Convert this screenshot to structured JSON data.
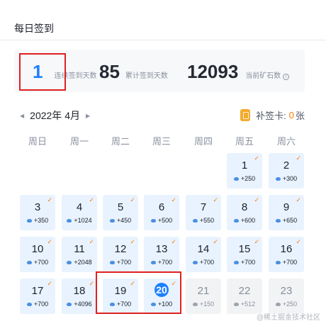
{
  "header": {
    "title": "每日签到"
  },
  "stats": {
    "streak": {
      "value": "1",
      "label": "连续签到天数"
    },
    "total": {
      "value": "85",
      "label": "累计签到天数"
    },
    "ore": {
      "value": "12093",
      "label": "当前矿石数",
      "icon": "info-icon"
    }
  },
  "calendar": {
    "prev_icon": "◀",
    "next_icon": "▶",
    "month_label": "2022年 4月",
    "makeup_label": "补签卡:",
    "makeup_count": "0",
    "makeup_unit": "张",
    "weekdays": [
      "周日",
      "周一",
      "周二",
      "周三",
      "周四",
      "周五",
      "周六"
    ],
    "check_mark": "✓",
    "days": [
      {
        "num": "1",
        "reward": "+250",
        "state": "signed"
      },
      {
        "num": "2",
        "reward": "+300",
        "state": "signed"
      },
      {
        "num": "3",
        "reward": "+350",
        "state": "signed"
      },
      {
        "num": "4",
        "reward": "+1024",
        "state": "signed"
      },
      {
        "num": "5",
        "reward": "+450",
        "state": "signed"
      },
      {
        "num": "6",
        "reward": "+500",
        "state": "signed"
      },
      {
        "num": "7",
        "reward": "+550",
        "state": "signed"
      },
      {
        "num": "8",
        "reward": "+600",
        "state": "signed"
      },
      {
        "num": "9",
        "reward": "+650",
        "state": "signed"
      },
      {
        "num": "10",
        "reward": "+700",
        "state": "signed"
      },
      {
        "num": "11",
        "reward": "+2048",
        "state": "signed"
      },
      {
        "num": "12",
        "reward": "+700",
        "state": "signed"
      },
      {
        "num": "13",
        "reward": "+700",
        "state": "signed"
      },
      {
        "num": "14",
        "reward": "+700",
        "state": "signed"
      },
      {
        "num": "15",
        "reward": "+700",
        "state": "signed"
      },
      {
        "num": "16",
        "reward": "+700",
        "state": "signed"
      },
      {
        "num": "17",
        "reward": "+700",
        "state": "signed"
      },
      {
        "num": "18",
        "reward": "+4096",
        "state": "signed"
      },
      {
        "num": "19",
        "reward": "+700",
        "state": "signed"
      },
      {
        "num": "20",
        "reward": "+100",
        "state": "today"
      },
      {
        "num": "21",
        "reward": "+150",
        "state": "future"
      },
      {
        "num": "22",
        "reward": "+512",
        "state": "future"
      },
      {
        "num": "23",
        "reward": "+250",
        "state": "future"
      }
    ]
  },
  "colors": {
    "accent": "#1e80ff",
    "signed_bg": "#e8f3ff",
    "future_bg": "#f2f3f5",
    "highlight": "#e02020",
    "check": "#ff7a00"
  },
  "watermark": "@稀土掘金技术社区"
}
